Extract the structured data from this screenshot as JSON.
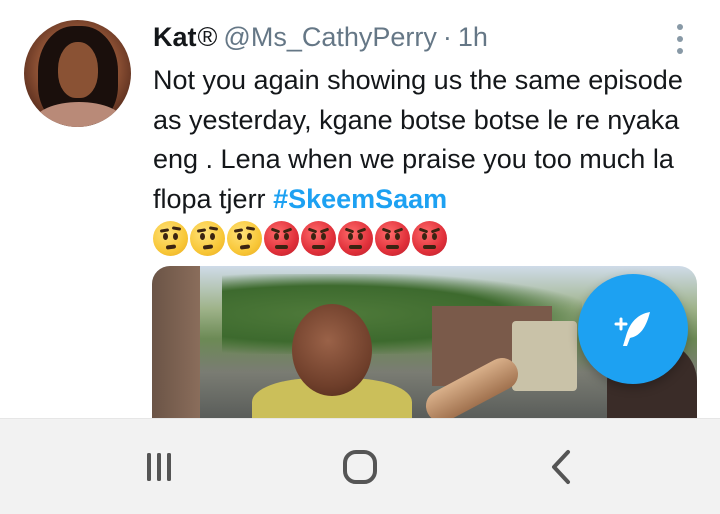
{
  "tweet": {
    "display_name": "Kat",
    "name_symbol": "®",
    "handle": "@Ms_CathyPerry",
    "separator": "·",
    "time": "1h",
    "text": "Not you again showing us the same episode as yesterday, kgane botse botse le re nyaka eng . Lena when we praise you too much la flopa tjerr ",
    "hashtag": "#SkeemSaam",
    "emojis": [
      "confused",
      "confused",
      "confused",
      "angry",
      "angry",
      "angry",
      "angry",
      "angry"
    ]
  },
  "icons": {
    "more": "more-vertical-icon",
    "compose": "compose-tweet-icon",
    "recents": "recent-apps-icon",
    "home": "home-icon",
    "back": "back-icon"
  },
  "colors": {
    "accent": "#1da1f2",
    "text": "#14171a",
    "secondary": "#657786",
    "navbar": "#f2f2f2"
  }
}
